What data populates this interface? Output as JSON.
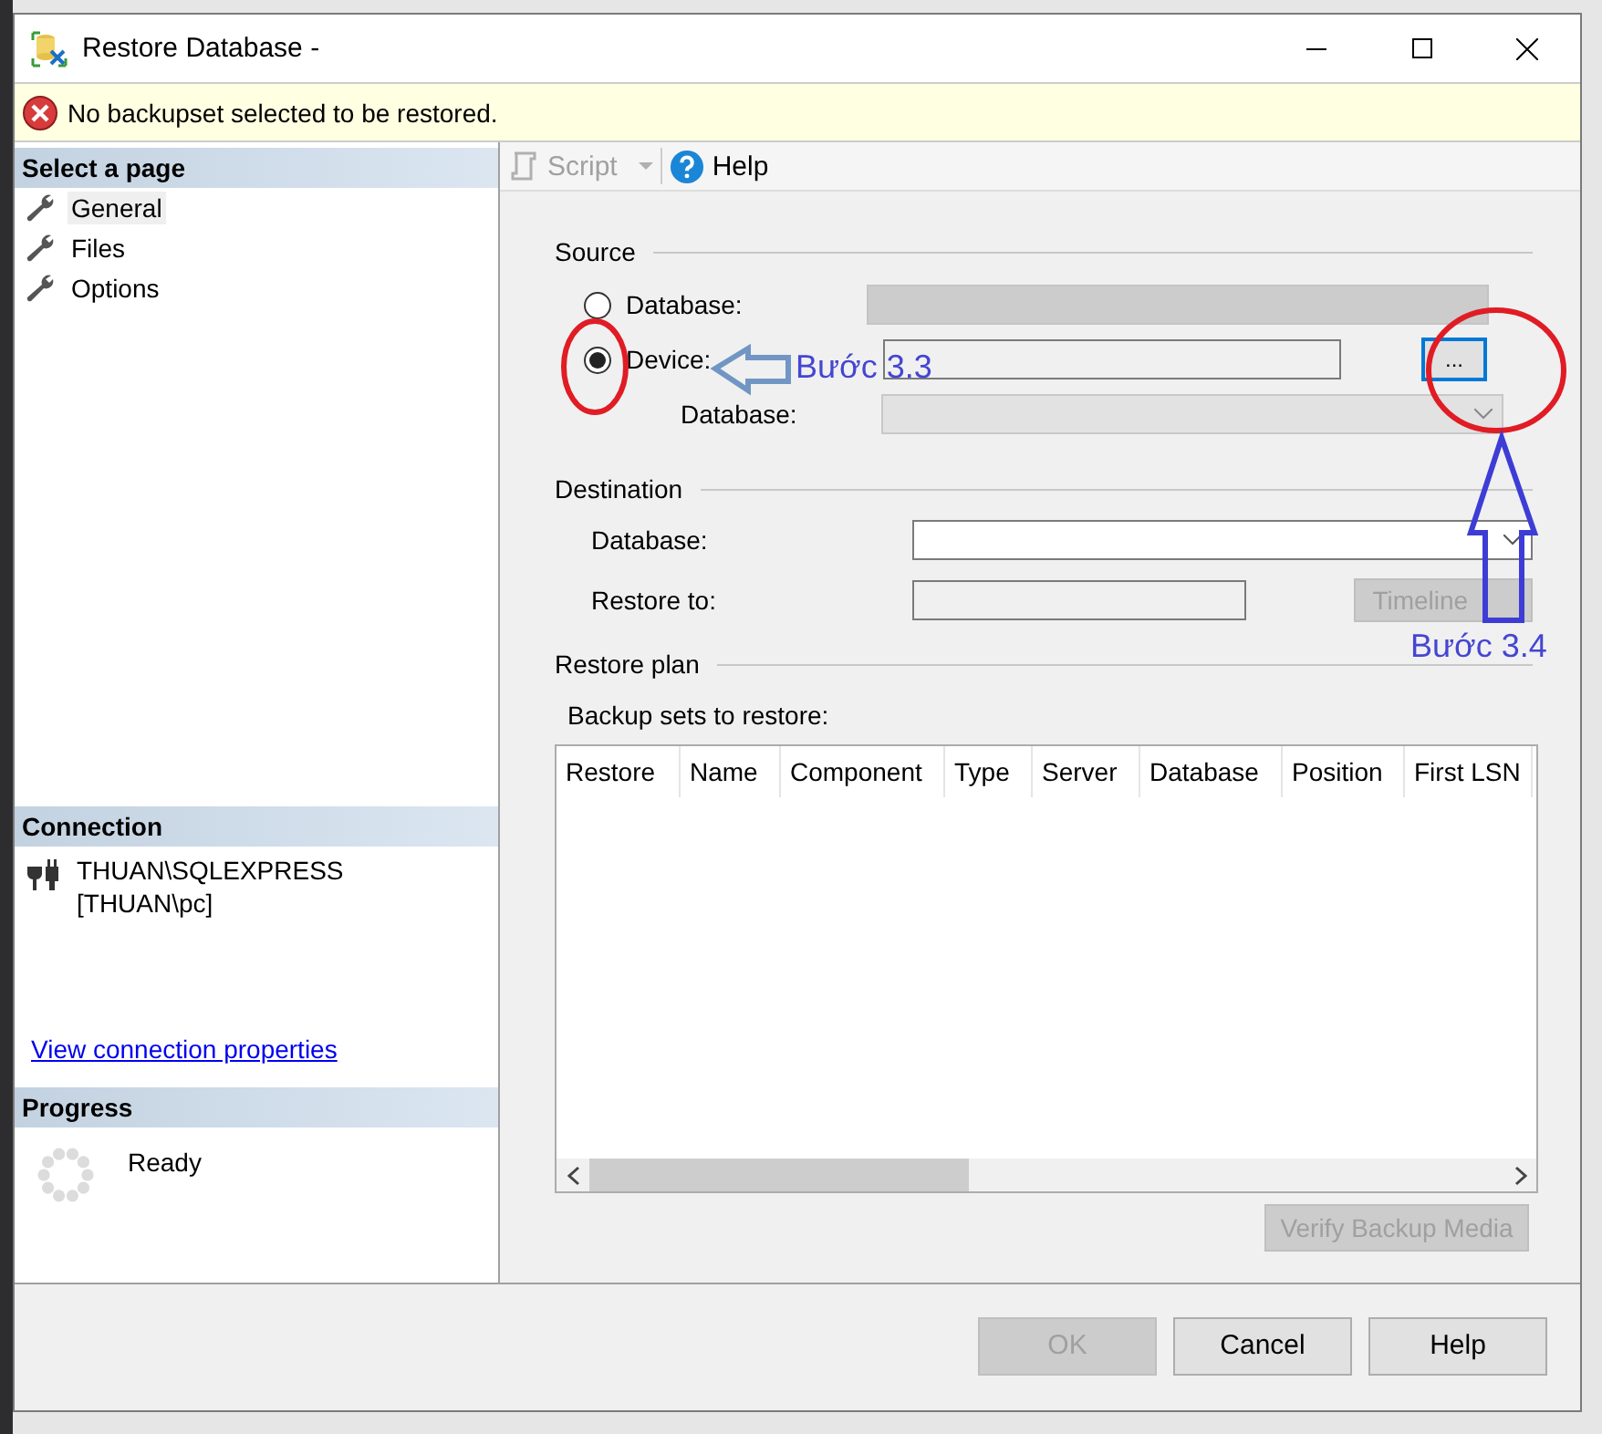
{
  "window": {
    "title": "Restore Database -"
  },
  "error_bar": {
    "message": "No backupset selected to be restored."
  },
  "sidebar": {
    "header": "Select a page",
    "items": [
      {
        "label": "General",
        "selected": true
      },
      {
        "label": "Files",
        "selected": false
      },
      {
        "label": "Options",
        "selected": false
      }
    ]
  },
  "connection": {
    "header": "Connection",
    "server": "THUAN\\SQLEXPRESS",
    "user": "[THUAN\\pc]",
    "link": "View connection properties"
  },
  "progress": {
    "header": "Progress",
    "status": "Ready"
  },
  "toolbar": {
    "script": "Script",
    "help": "Help"
  },
  "source": {
    "title": "Source",
    "options": [
      {
        "label": "Database:",
        "selected": false
      },
      {
        "label": "Device:",
        "selected": true
      }
    ],
    "database_label": "Database:",
    "browse_button": "..."
  },
  "destination": {
    "title": "Destination",
    "database_label": "Database:",
    "restore_to_label": "Restore to:",
    "timeline_button": {
      "label": "Timeline",
      "disabled": true
    }
  },
  "restore_plan": {
    "title": "Restore plan",
    "grid_label": "Backup sets to restore:",
    "columns": [
      "Restore",
      "Name",
      "Component",
      "Type",
      "Server",
      "Database",
      "Position",
      "First LSN"
    ],
    "verify_button": {
      "label": "Verify Backup Media",
      "disabled": true
    }
  },
  "buttons": [
    {
      "label": "OK",
      "disabled": true
    },
    {
      "label": "Cancel",
      "disabled": false
    },
    {
      "label": "Help",
      "disabled": false
    }
  ],
  "annotations": [
    {
      "kind": "left",
      "text": "Bước 3.3"
    },
    {
      "kind": "up",
      "text": "Bước 3.4"
    }
  ]
}
